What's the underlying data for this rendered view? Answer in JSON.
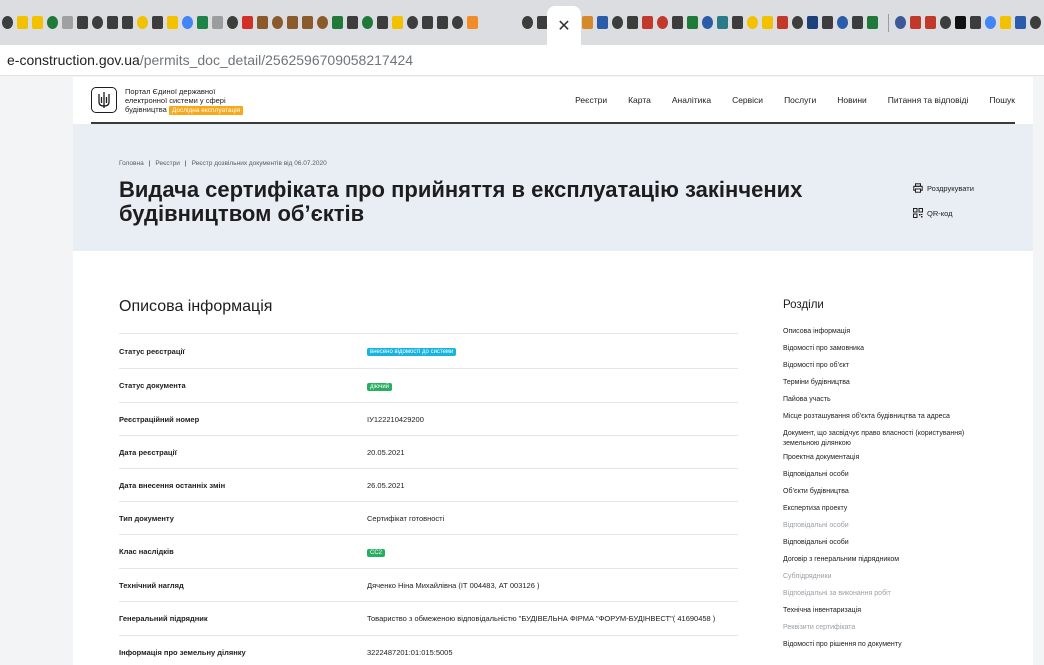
{
  "browser": {
    "active_tab_close": "✕",
    "favicons": [
      "#3d3d3d",
      "#f2c200",
      "#f2c200",
      "#1f7a3a",
      "#a0a0a0",
      "#3d3d3d",
      "#3d3d3d",
      "#3d3d3d",
      "#3d3d3d",
      "#f2c200",
      "#3d3d3d",
      "#f2c200",
      "#4285f4",
      "#1d8348",
      "#9c9c9c",
      "#3d3d3d",
      "#d22f27",
      "#8a5a2b",
      "#8a5a2b",
      "#8a5a2b",
      "#8a5a2b",
      "#8a5a2b",
      "#1f7a3a",
      "#3d3d3d",
      "#1f7a3a",
      "#3d3d3d",
      "#f2c200",
      "#3d3d3d",
      "#3d3d3d",
      "#3d3d3d",
      "#3d3d3d",
      "#f28c28"
    ],
    "favicons_right": [
      "#3d3d3d",
      "#3d3d3d",
      "#2a5caa",
      "#3d3d3d",
      "#d48a2b",
      "#2a5caa",
      "#3d3d3d",
      "#3d3d3d",
      "#c0392b",
      "#c0392b",
      "#3d3d3d",
      "#1f7a3a",
      "#2a5caa",
      "#2a7a8a",
      "#3d3d3d",
      "#f2c200",
      "#f2c200",
      "#c0392b",
      "#3d3d3d",
      "#1d3f7a",
      "#3d3d3d",
      "#2a5caa",
      "#3d3d3d",
      "#1f7a3a"
    ],
    "favicons_far": [
      "#3b5998",
      "#c0392b",
      "#c0392b",
      "#3d3d3d",
      "#111111",
      "#3d3d3d",
      "#4285f4",
      "#f2c200",
      "#2a5caa",
      "#3d3d3d"
    ],
    "url_host": "e-construction.gov.ua",
    "url_path": "/permits_doc_detail/2562596709058217424"
  },
  "header": {
    "portal_name_lines": [
      "Портал Єдиної державної",
      "електронної системи у сфері",
      "будівництва"
    ],
    "trial_badge": "Дослідна експлуатація",
    "nav": [
      "Реєстри",
      "Карта",
      "Аналітика",
      "Сервіси",
      "Послуги",
      "Новини",
      "Питання та відповіді",
      "Пошук"
    ]
  },
  "hero": {
    "breadcrumb": [
      "Головна",
      "Реєстри",
      "Реєстр дозвільних документів від 06.07.2020"
    ],
    "title": "Видача сертифіката про прийняття в експлуатацію закінчених будівництвом об’єктів",
    "print_label": "Роздрукувати",
    "qr_label": "QR-код"
  },
  "main": {
    "section_title": "Описова інформація",
    "rows": [
      {
        "label": "Статус реєстрації",
        "value": "внесено відомості до системи",
        "badge": true,
        "badge_color": "#17b4e0",
        "height": 35
      },
      {
        "label": "Статус документа",
        "value": "діючий",
        "badge": true,
        "badge_color": "#27ae60",
        "height": 34
      },
      {
        "label": "Реєстраційний номер",
        "value": "ІУ122210429200",
        "badge": false,
        "height": 33
      },
      {
        "label": "Дата реєстрації",
        "value": "20.05.2021",
        "badge": false,
        "height": 33
      },
      {
        "label": "Дата внесення останніх змін",
        "value": "26.05.2021",
        "badge": false,
        "height": 33
      },
      {
        "label": "Тип документу",
        "value": "Сертифікат готовності",
        "badge": false,
        "height": 33
      },
      {
        "label": "Клас наслідків",
        "value": "СС2",
        "badge": true,
        "badge_color": "#27ae60",
        "height": 34
      },
      {
        "label": "Технічний нагляд",
        "value": "Дяченко Ніна Михайлівна (ІТ 004483, АТ 003126 )",
        "badge": false,
        "height": 33
      },
      {
        "label": "Генеральний підрядник",
        "value": "Товариство з обмеженою відповідальністю \"БУДІВЕЛЬНА ФІРМА \"ФОРУМ-БУДІНВЕСТ\"( 41690458 )",
        "badge": false,
        "height": 34
      },
      {
        "label": "Інформація про земельну ділянку",
        "value": "3222487201:01:015:5005",
        "badge": false,
        "height": 33
      }
    ]
  },
  "sidebar": {
    "title": "Розділи",
    "items": [
      {
        "label": "Описова інформація",
        "muted": false
      },
      {
        "label": "Відомості про замовника",
        "muted": false
      },
      {
        "label": "Відомості про об’єкт",
        "muted": false
      },
      {
        "label": "Терміни будівництва",
        "muted": false
      },
      {
        "label": "Пайова участь",
        "muted": false
      },
      {
        "label": "Місце розташування об’єкта будівництва та адреса",
        "muted": false
      },
      {
        "label": "Документ, що засвідчує право власності (користування) земельною ділянкою",
        "muted": false
      },
      {
        "label": "Проектна документація",
        "muted": false
      },
      {
        "label": "Відповідальні особи",
        "muted": false
      },
      {
        "label": "Об’єкти будівництва",
        "muted": false
      },
      {
        "label": "Експертиза проекту",
        "muted": false
      },
      {
        "label": "Відповідальні особи",
        "muted": true
      },
      {
        "label": "Відповідальні особи",
        "muted": false
      },
      {
        "label": "Договір з генеральним підрядником",
        "muted": false
      },
      {
        "label": "Субпідрядники",
        "muted": true
      },
      {
        "label": "Відповідальні за виконання робіт",
        "muted": true
      },
      {
        "label": "Технічна інвентаризація",
        "muted": false
      },
      {
        "label": "Реквізити сертифіката",
        "muted": true
      },
      {
        "label": "Відомості про рішення по документу",
        "muted": false
      }
    ]
  }
}
